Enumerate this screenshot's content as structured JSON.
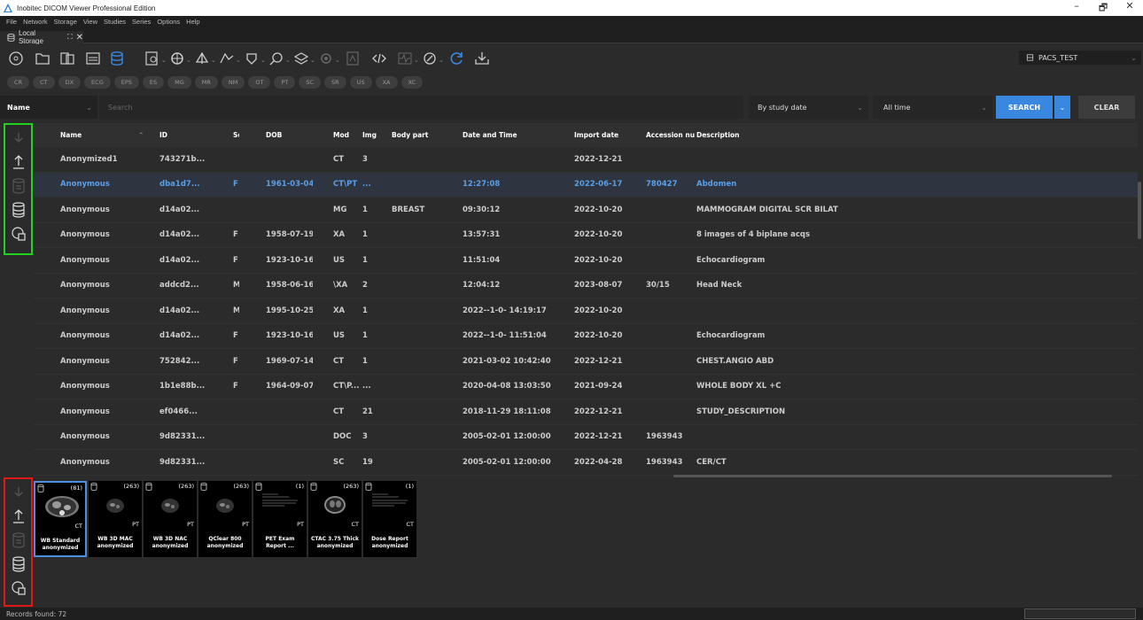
{
  "window": {
    "title": "Inobitec DICOM Viewer Professional Edition",
    "minimize": "–",
    "restore": "🗗",
    "close": "✕"
  },
  "menu": [
    "File",
    "Network",
    "Storage",
    "View",
    "Studies",
    "Series",
    "Options",
    "Help"
  ],
  "tab": {
    "label": "Local Storage",
    "close": "✕"
  },
  "pacs": {
    "label": "PACS_TEST"
  },
  "modalities": [
    "CR",
    "CT",
    "DX",
    "ECG",
    "EPS",
    "ES",
    "MG",
    "MR",
    "NM",
    "OT",
    "PT",
    "SC",
    "SR",
    "US",
    "XA",
    "XC"
  ],
  "filter": {
    "field": "Name",
    "search_placeholder": "Search",
    "date_type": "By study date",
    "time_range": "All time",
    "search_button": "SEARCH",
    "clear_button": "CLEAR"
  },
  "table": {
    "columns": {
      "name": "Name",
      "id": "ID",
      "sex": "Sex",
      "dob": "DOB",
      "mod": "Mod",
      "img": "Img",
      "body_part": "Body part",
      "datetime": "Date and Time",
      "import_date": "Import date",
      "accession": "Accession nu",
      "description": "Description"
    },
    "rows": [
      {
        "name": "Anonymized1",
        "id": "743271b...",
        "sex": "",
        "dob": "",
        "mod": "CT",
        "img": "3",
        "body_part": "",
        "datetime": "",
        "import_date": "2022-12-21",
        "accession": "",
        "description": ""
      },
      {
        "name": "Anonymous",
        "id": "dba1d7...",
        "sex": "F",
        "dob": "1961-03-04",
        "mod": "CT\\PT",
        "img": "...",
        "body_part": "",
        "datetime": "12:27:08",
        "import_date": "2022-06-17",
        "accession": "780427",
        "description": "Abdomen"
      },
      {
        "name": "Anonymous",
        "id": "d14a02...",
        "sex": "",
        "dob": "",
        "mod": "MG",
        "img": "1",
        "body_part": "BREAST",
        "datetime": "09:30:12",
        "import_date": "2022-10-20",
        "accession": "",
        "description": "MAMMOGRAM DIGITAL SCR BILAT"
      },
      {
        "name": "Anonymous",
        "id": "d14a02...",
        "sex": "F",
        "dob": "1958-07-19",
        "mod": "XA",
        "img": "1",
        "body_part": "",
        "datetime": "13:57:31",
        "import_date": "2022-10-20",
        "accession": "",
        "description": "8 images of 4 biplane acqs"
      },
      {
        "name": "Anonymous",
        "id": "d14a02...",
        "sex": "F",
        "dob": "1923-10-16",
        "mod": "US",
        "img": "1",
        "body_part": "",
        "datetime": "11:51:04",
        "import_date": "2022-10-20",
        "accession": "",
        "description": "Echocardiogram"
      },
      {
        "name": "Anonymous",
        "id": "addcd2...",
        "sex": "M",
        "dob": "1958-06-16",
        "mod": "\\XA",
        "img": "2",
        "body_part": "",
        "datetime": "12:04:12",
        "import_date": "2023-08-07",
        "accession": "30/15",
        "description": "Head Neck"
      },
      {
        "name": "Anonymous",
        "id": "d14a02...",
        "sex": "M",
        "dob": "1995-10-25",
        "mod": "XA",
        "img": "1",
        "body_part": "",
        "datetime": "2022--1-0- 14:19:17",
        "import_date": "2022-10-20",
        "accession": "",
        "description": ""
      },
      {
        "name": "Anonymous",
        "id": "d14a02...",
        "sex": "F",
        "dob": "1923-10-16",
        "mod": "US",
        "img": "1",
        "body_part": "",
        "datetime": "2022--1-0- 11:51:04",
        "import_date": "2022-10-20",
        "accession": "",
        "description": "Echocardiogram"
      },
      {
        "name": "Anonymous",
        "id": "752842...",
        "sex": "F",
        "dob": "1969-07-14",
        "mod": "CT",
        "img": "1",
        "body_part": "",
        "datetime": "2021-03-02 10:42:40",
        "import_date": "2022-12-21",
        "accession": "",
        "description": "CHEST.ANGIO ABD"
      },
      {
        "name": "Anonymous",
        "id": "1b1e88b...",
        "sex": "F",
        "dob": "1964-09-07",
        "mod": "CT\\P...",
        "img": "...",
        "body_part": "",
        "datetime": "2020-04-08 13:03:50",
        "import_date": "2021-09-24",
        "accession": "",
        "description": "WHOLE BODY XL +C"
      },
      {
        "name": "Anonymous",
        "id": "ef0466...",
        "sex": "",
        "dob": "",
        "mod": "CT",
        "img": "21",
        "body_part": "",
        "datetime": "2018-11-29 18:11:08",
        "import_date": "2022-12-21",
        "accession": "",
        "description": "STUDY_DESCRIPTION"
      },
      {
        "name": "Anonymous",
        "id": "9d82331...",
        "sex": "",
        "dob": "",
        "mod": "DOC",
        "img": "3",
        "body_part": "",
        "datetime": "2005-02-01 12:00:00",
        "import_date": "2022-12-21",
        "accession": "1963943",
        "description": ""
      },
      {
        "name": "Anonymous",
        "id": "9d82331...",
        "sex": "",
        "dob": "",
        "mod": "SC",
        "img": "19",
        "body_part": "",
        "datetime": "2005-02-01 12:00:00",
        "import_date": "2022-04-28",
        "accession": "1963943",
        "description": "CER/CT"
      }
    ]
  },
  "series": [
    {
      "count": "(81)",
      "mod": "CT",
      "label1": "WB Standard",
      "label2": "anonymized",
      "kind": "ct-abd"
    },
    {
      "count": "(263)",
      "mod": "PT",
      "label1": "WB 3D MAC",
      "label2": "anonymized",
      "kind": "pt"
    },
    {
      "count": "(263)",
      "mod": "PT",
      "label1": "WB 3D NAC",
      "label2": "anonymized",
      "kind": "pt"
    },
    {
      "count": "(263)",
      "mod": "PT",
      "label1": "QClear 800",
      "label2": "anonymized",
      "kind": "pt"
    },
    {
      "count": "(1)",
      "mod": "PT",
      "label1": "PET Exam",
      "label2": "Report ...",
      "kind": "doc"
    },
    {
      "count": "(263)",
      "mod": "CT",
      "label1": "CTAC 3.75 Thick",
      "label2": "anonymized",
      "kind": "ct"
    },
    {
      "count": "(1)",
      "mod": "CT",
      "label1": "Dose Report",
      "label2": "anonymized",
      "kind": "doc"
    }
  ],
  "status": {
    "records": "Records found: 72"
  },
  "colors": {
    "accent": "#3a87e0",
    "selection_text": "#5a9fe6",
    "highlight_green": "#22d122",
    "highlight_red": "#e01818"
  }
}
